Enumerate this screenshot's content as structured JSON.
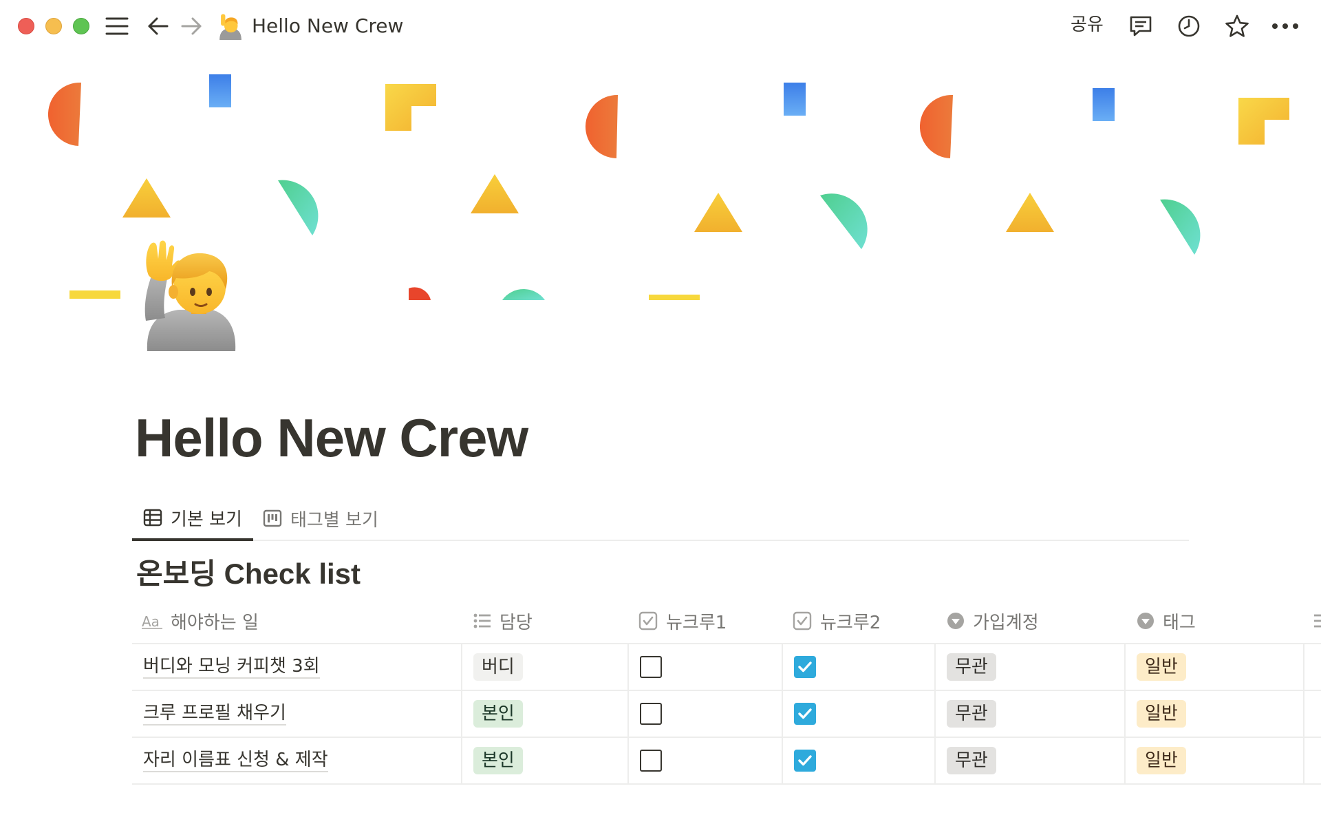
{
  "window": {
    "title": "Hello New Crew",
    "share_label": "공유"
  },
  "icons": {
    "menu": "hamburger-menu-icon",
    "back": "arrow-left-icon",
    "forward": "arrow-right-icon",
    "page_emoji": "person-raising-hand-emoji",
    "comments": "comment-icon",
    "updates": "clock-icon",
    "favorite": "star-icon",
    "more": "more-horizontal-icon"
  },
  "page": {
    "title": "Hello New Crew"
  },
  "views": {
    "tabs": [
      {
        "label": "기본 보기",
        "icon": "table-icon",
        "active": true
      },
      {
        "label": "태그별 보기",
        "icon": "board-icon",
        "active": false
      }
    ]
  },
  "database": {
    "title": "온보딩 Check list",
    "columns": [
      {
        "label": "해야하는 일",
        "icon": "title-aa-icon"
      },
      {
        "label": "담당",
        "icon": "list-icon"
      },
      {
        "label": "뉴크루1",
        "icon": "checkbox-icon"
      },
      {
        "label": "뉴크루2",
        "icon": "checkbox-icon"
      },
      {
        "label": "가입계정",
        "icon": "select-icon"
      },
      {
        "label": "태그",
        "icon": "select-icon"
      }
    ],
    "rows": [
      {
        "task": "버디와 모닝 커피챗 3회",
        "owner": "버디",
        "crew1": false,
        "crew2": true,
        "account": "무관",
        "tag": "일반"
      },
      {
        "task": "크루 프로필 채우기",
        "owner": "본인",
        "crew1": false,
        "crew2": true,
        "account": "무관",
        "tag": "일반"
      },
      {
        "task": "자리 이름표 신청 & 제작",
        "owner": "본인",
        "crew1": false,
        "crew2": true,
        "account": "무관",
        "tag": "일반"
      }
    ]
  },
  "colors": {
    "checkbox_checked": "#2eaadc",
    "chip_buddy": "#f1f1ef",
    "chip_self": "#dbeddb",
    "chip_gray": "#e3e2e0",
    "chip_yellow": "#fdecc8"
  }
}
